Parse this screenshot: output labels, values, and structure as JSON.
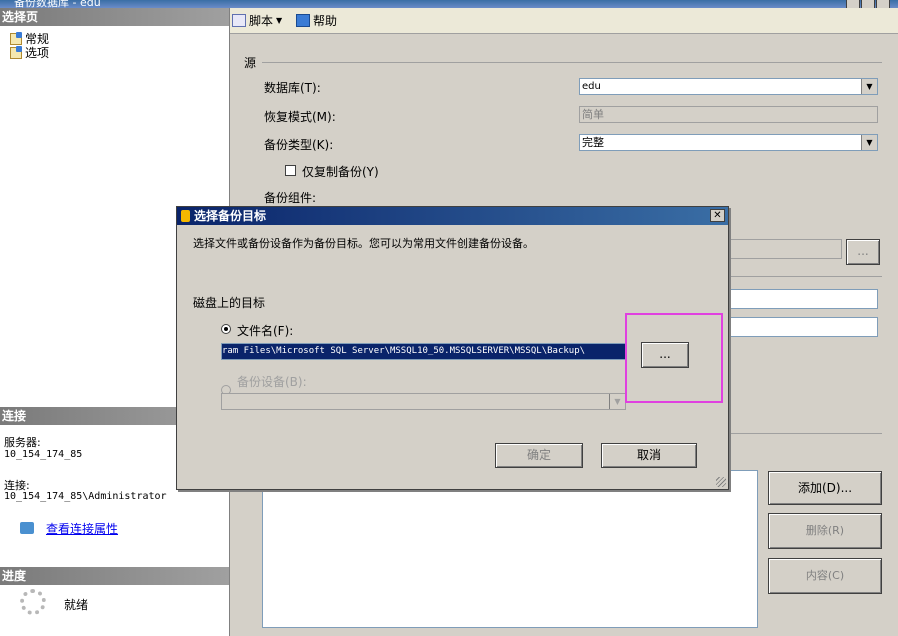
{
  "window": {
    "title": "备份数据库 - edu"
  },
  "left": {
    "select_page_header": "选择页",
    "pages": [
      "常规",
      "选项"
    ],
    "connection_header": "连接",
    "server_label": "服务器:",
    "server_value": "10_154_174_85",
    "connection_label": "连接:",
    "connection_value": "10_154_174_85\\Administrator",
    "view_props_link": "查看连接属性",
    "progress_header": "进度",
    "progress_status": "就绪"
  },
  "toolbar": {
    "script_label": "脚本",
    "help_label": "帮助"
  },
  "main": {
    "source_label": "源",
    "database_label": "数据库(T):",
    "database_value": "edu",
    "recovery_label": "恢复模式(M):",
    "recovery_value": "简单",
    "backup_type_label": "备份类型(K):",
    "backup_type_value": "完整",
    "copy_only_label": "仅复制备份(Y)",
    "component_label": "备份组件:",
    "browse_label": "...",
    "add_button": "添加(D)...",
    "delete_button": "删除(R)",
    "contents_button": "内容(C)"
  },
  "dialog": {
    "title": "选择备份目标",
    "description": "选择文件或备份设备作为备份目标。您可以为常用文件创建备份设备。",
    "disk_label": "磁盘上的目标",
    "file_radio_label": "文件名(F):",
    "file_path": "ram Files\\Microsoft SQL Server\\MSSQL10_50.MSSQLSERVER\\MSSQL\\Backup\\",
    "browse_label": "...",
    "device_radio_label": "备份设备(B):",
    "ok_button": "确定",
    "cancel_button": "取消",
    "close_glyph": "✕"
  },
  "colors": {
    "highlight": "#e040e0",
    "title_bar": "#0a246a"
  }
}
